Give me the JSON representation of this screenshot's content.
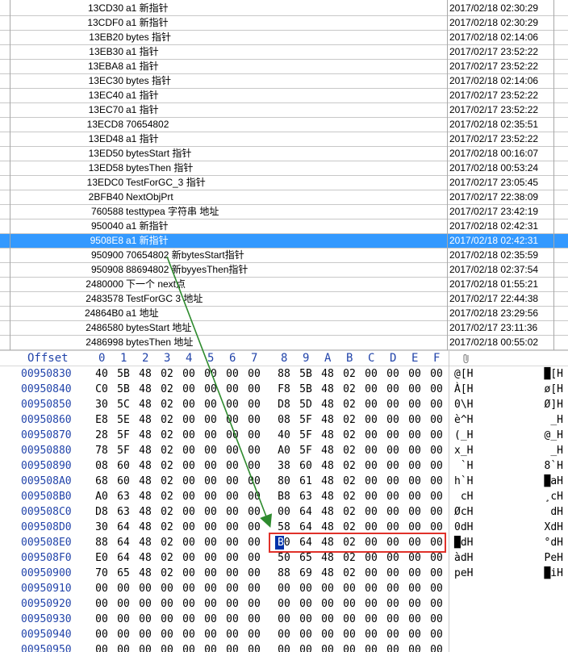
{
  "list": {
    "rows": [
      {
        "addr": "13CD30",
        "desc": "a1 新指针",
        "time": "2017/02/18  02:30:29"
      },
      {
        "addr": "13CDF0",
        "desc": "a1 新指针",
        "time": "2017/02/18  02:30:29"
      },
      {
        "addr": "13EB20",
        "desc": "bytes 指针",
        "time": "2017/02/18  02:14:06"
      },
      {
        "addr": "13EB30",
        "desc": "a1 指针",
        "time": "2017/02/17  23:52:22"
      },
      {
        "addr": "13EBA8",
        "desc": "a1 指针",
        "time": "2017/02/17  23:52:22"
      },
      {
        "addr": "13EC30",
        "desc": "bytes 指针",
        "time": "2017/02/18  02:14:06"
      },
      {
        "addr": "13EC40",
        "desc": "a1 指针",
        "time": "2017/02/17  23:52:22"
      },
      {
        "addr": "13EC70",
        "desc": "a1 指针",
        "time": "2017/02/17  23:52:22"
      },
      {
        "addr": "13ECD8",
        "desc": "70654802",
        "time": "2017/02/18  02:35:51"
      },
      {
        "addr": "13ED48",
        "desc": "a1 指针",
        "time": "2017/02/17  23:52:22"
      },
      {
        "addr": "13ED50",
        "desc": "bytesStart 指针",
        "time": "2017/02/18  00:16:07"
      },
      {
        "addr": "13ED58",
        "desc": "bytesThen 指针",
        "time": "2017/02/18  00:53:24"
      },
      {
        "addr": "13EDC0",
        "desc": "TestForGC_3  指针",
        "time": "2017/02/17  23:05:45"
      },
      {
        "addr": "2BFB40",
        "desc": "NextObjPrt",
        "time": "2017/02/17  22:38:09"
      },
      {
        "addr": "760588",
        "desc": "testtypea 字符串 地址",
        "time": "2017/02/17  23:42:19"
      },
      {
        "addr": "950040",
        "desc": "a1 新指针",
        "time": "2017/02/18  02:42:31"
      },
      {
        "addr": "9508E8",
        "desc": "a1 新指针",
        "time": "2017/02/18  02:42:31"
      },
      {
        "addr": "950900",
        "desc": "70654802   新bytesStart指针",
        "time": "2017/02/18  02:35:59"
      },
      {
        "addr": "950908",
        "desc": "88694802 新byyesThen指针",
        "time": "2017/02/18  02:37:54"
      },
      {
        "addr": "2480000",
        "desc": "下一个 next点",
        "time": "2017/02/18  01:55:21"
      },
      {
        "addr": "2483578",
        "desc": "TestForGC 3 地址",
        "time": "2017/02/17  22:44:38"
      },
      {
        "addr": "24864B0",
        "desc": "a1 地址",
        "time": "2017/02/18  23:29:56"
      },
      {
        "addr": "2486580",
        "desc": "bytesStart 地址",
        "time": "2017/02/17  23:11:36"
      },
      {
        "addr": "2486998",
        "desc": "bytesThen 地址",
        "time": "2017/02/18  00:55:02"
      }
    ],
    "selected_index": 16
  },
  "hex": {
    "offset_label": "Offset",
    "col_labels": [
      "0",
      "1",
      "2",
      "3",
      "4",
      "5",
      "6",
      "7",
      "8",
      "9",
      "A",
      "B",
      "C",
      "D",
      "E",
      "F"
    ],
    "rows": [
      {
        "offset": "00950830",
        "bytes": [
          "40",
          "5B",
          "48",
          "02",
          "00",
          "00",
          "00",
          "00",
          "88",
          "5B",
          "48",
          "02",
          "00",
          "00",
          "00",
          "00"
        ],
        "ascii_a": "@[H",
        "ascii_b": "█[H"
      },
      {
        "offset": "00950840",
        "bytes": [
          "C0",
          "5B",
          "48",
          "02",
          "00",
          "00",
          "00",
          "00",
          "F8",
          "5B",
          "48",
          "02",
          "00",
          "00",
          "00",
          "00"
        ],
        "ascii_a": "À[H",
        "ascii_b": "ø[H"
      },
      {
        "offset": "00950850",
        "bytes": [
          "30",
          "5C",
          "48",
          "02",
          "00",
          "00",
          "00",
          "00",
          "D8",
          "5D",
          "48",
          "02",
          "00",
          "00",
          "00",
          "00"
        ],
        "ascii_a": "0\\H",
        "ascii_b": "Ø]H"
      },
      {
        "offset": "00950860",
        "bytes": [
          "E8",
          "5E",
          "48",
          "02",
          "00",
          "00",
          "00",
          "00",
          "08",
          "5F",
          "48",
          "02",
          "00",
          "00",
          "00",
          "00"
        ],
        "ascii_a": "è^H",
        "ascii_b": " _H"
      },
      {
        "offset": "00950870",
        "bytes": [
          "28",
          "5F",
          "48",
          "02",
          "00",
          "00",
          "00",
          "00",
          "40",
          "5F",
          "48",
          "02",
          "00",
          "00",
          "00",
          "00"
        ],
        "ascii_a": "(_H",
        "ascii_b": "@_H"
      },
      {
        "offset": "00950880",
        "bytes": [
          "78",
          "5F",
          "48",
          "02",
          "00",
          "00",
          "00",
          "00",
          "A0",
          "5F",
          "48",
          "02",
          "00",
          "00",
          "00",
          "00"
        ],
        "ascii_a": "x_H",
        "ascii_b": " _H"
      },
      {
        "offset": "00950890",
        "bytes": [
          "08",
          "60",
          "48",
          "02",
          "00",
          "00",
          "00",
          "00",
          "38",
          "60",
          "48",
          "02",
          "00",
          "00",
          "00",
          "00"
        ],
        "ascii_a": " `H",
        "ascii_b": "8`H"
      },
      {
        "offset": "009508A0",
        "bytes": [
          "68",
          "60",
          "48",
          "02",
          "00",
          "00",
          "00",
          "00",
          "80",
          "61",
          "48",
          "02",
          "00",
          "00",
          "00",
          "00"
        ],
        "ascii_a": "h`H",
        "ascii_b": "█aH"
      },
      {
        "offset": "009508B0",
        "bytes": [
          "A0",
          "63",
          "48",
          "02",
          "00",
          "00",
          "00",
          "00",
          "B8",
          "63",
          "48",
          "02",
          "00",
          "00",
          "00",
          "00"
        ],
        "ascii_a": " cH",
        "ascii_b": "¸cH"
      },
      {
        "offset": "009508C0",
        "bytes": [
          "D8",
          "63",
          "48",
          "02",
          "00",
          "00",
          "00",
          "00",
          "00",
          "64",
          "48",
          "02",
          "00",
          "00",
          "00",
          "00"
        ],
        "ascii_a": "ØcH",
        "ascii_b": " dH"
      },
      {
        "offset": "009508D0",
        "bytes": [
          "30",
          "64",
          "48",
          "02",
          "00",
          "00",
          "00",
          "00",
          "58",
          "64",
          "48",
          "02",
          "00",
          "00",
          "00",
          "00"
        ],
        "ascii_a": "0dH",
        "ascii_b": "XdH"
      },
      {
        "offset": "009508E0",
        "bytes": [
          "88",
          "64",
          "48",
          "02",
          "00",
          "00",
          "00",
          "00",
          "B0",
          "64",
          "48",
          "02",
          "00",
          "00",
          "00",
          "00"
        ],
        "ascii_a": "█dH",
        "ascii_b": "°dH"
      },
      {
        "offset": "009508F0",
        "bytes": [
          "E0",
          "64",
          "48",
          "02",
          "00",
          "00",
          "00",
          "00",
          "50",
          "65",
          "48",
          "02",
          "00",
          "00",
          "00",
          "00"
        ],
        "ascii_a": "àdH",
        "ascii_b": "PeH"
      },
      {
        "offset": "00950900",
        "bytes": [
          "70",
          "65",
          "48",
          "02",
          "00",
          "00",
          "00",
          "00",
          "88",
          "69",
          "48",
          "02",
          "00",
          "00",
          "00",
          "00"
        ],
        "ascii_a": "peH",
        "ascii_b": "█iH"
      },
      {
        "offset": "00950910",
        "bytes": [
          "00",
          "00",
          "00",
          "00",
          "00",
          "00",
          "00",
          "00",
          "00",
          "00",
          "00",
          "00",
          "00",
          "00",
          "00",
          "00"
        ],
        "ascii_a": "",
        "ascii_b": ""
      },
      {
        "offset": "00950920",
        "bytes": [
          "00",
          "00",
          "00",
          "00",
          "00",
          "00",
          "00",
          "00",
          "00",
          "00",
          "00",
          "00",
          "00",
          "00",
          "00",
          "00"
        ],
        "ascii_a": "",
        "ascii_b": ""
      },
      {
        "offset": "00950930",
        "bytes": [
          "00",
          "00",
          "00",
          "00",
          "00",
          "00",
          "00",
          "00",
          "00",
          "00",
          "00",
          "00",
          "00",
          "00",
          "00",
          "00"
        ],
        "ascii_a": "",
        "ascii_b": ""
      },
      {
        "offset": "00950940",
        "bytes": [
          "00",
          "00",
          "00",
          "00",
          "00",
          "00",
          "00",
          "00",
          "00",
          "00",
          "00",
          "00",
          "00",
          "00",
          "00",
          "00"
        ],
        "ascii_a": "",
        "ascii_b": ""
      },
      {
        "offset": "00950950",
        "bytes": [
          "00",
          "00",
          "00",
          "00",
          "00",
          "00",
          "00",
          "00",
          "00",
          "00",
          "00",
          "00",
          "00",
          "00",
          "00",
          "00"
        ],
        "ascii_a": "",
        "ascii_b": ""
      }
    ],
    "cursor": {
      "row": 11,
      "col": 8
    },
    "highlight": {
      "row": 11,
      "from_col": 8,
      "to_col": 15
    }
  },
  "colors": {
    "selection": "#3399ff",
    "offset_text": "#2244aa",
    "highlight_box": "#e0312a",
    "arrow": "#2e8b2e",
    "cursor": "#0033aa"
  },
  "icons": {
    "attachment": "paperclip-icon"
  }
}
